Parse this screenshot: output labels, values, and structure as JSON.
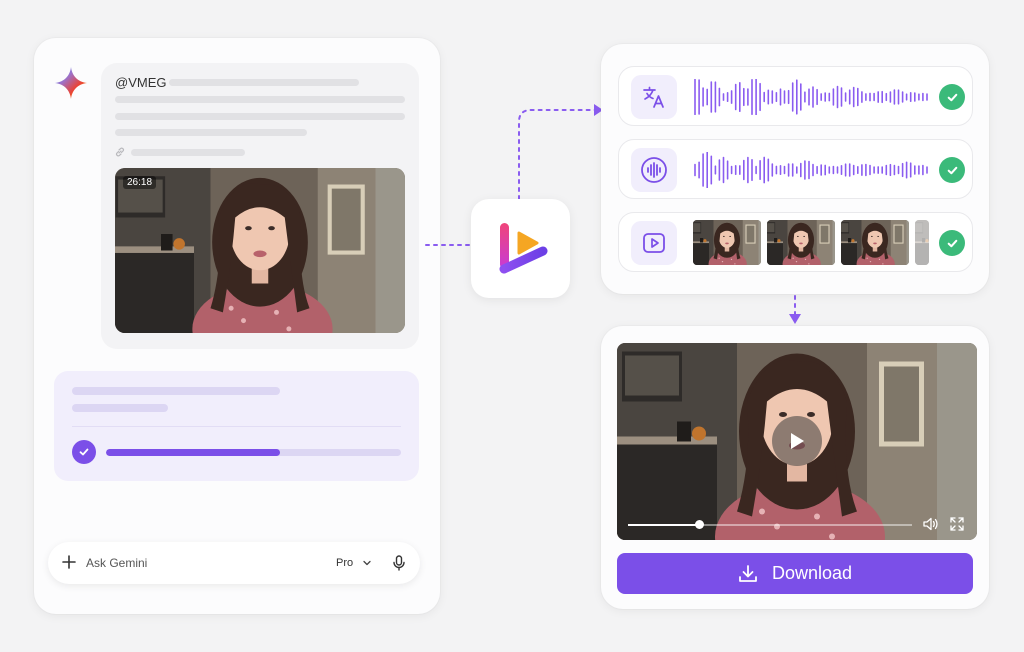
{
  "chat": {
    "handle": "@VMEG",
    "video_duration": "26:18",
    "progress": 0.59,
    "input_placeholder": "Ask Gemini",
    "model_label": "Pro"
  },
  "pipeline": {
    "rows": [
      {
        "icon": "translate-icon",
        "status": "check-icon"
      },
      {
        "icon": "voice-icon",
        "status": "check-icon"
      },
      {
        "icon": "video-play-icon",
        "status": "check-icon"
      }
    ]
  },
  "player": {
    "playback_progress": 0.25,
    "download_label": "Download"
  },
  "colors": {
    "accent": "#7b4fe8",
    "accent_light": "#f1eefc",
    "success": "#3bba7a",
    "background": "#f3f3f4"
  }
}
